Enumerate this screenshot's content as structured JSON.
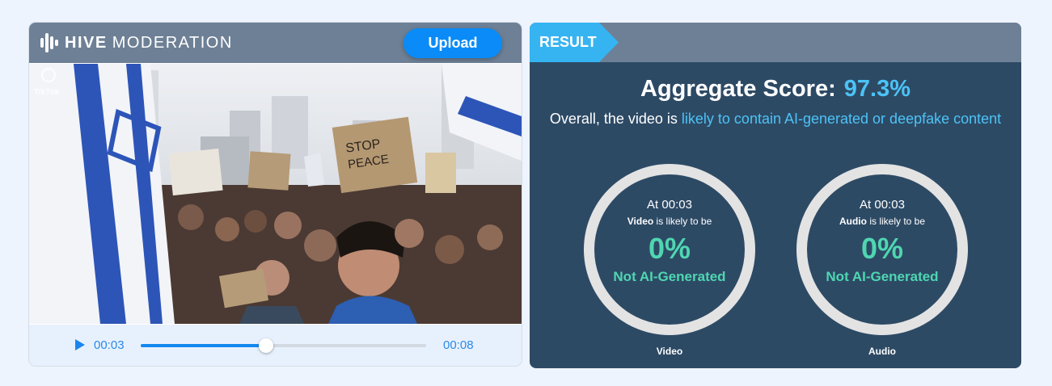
{
  "brand": {
    "name_bold": "HIVE",
    "name_light": "MODERATION"
  },
  "upload_label": "Upload",
  "player": {
    "current_time": "00:03",
    "total_time": "00:08",
    "progress": 0.44,
    "watermark": "TikTok"
  },
  "result": {
    "tab_label": "RESULT",
    "aggregate_label": "Aggregate Score:",
    "aggregate_score": "97.3%",
    "overall_prefix": "Overall, the video is ",
    "overall_highlight": "likely to contain AI-generated or deepfake content",
    "gauges": [
      {
        "timestamp": "At 00:03",
        "subject": "Video",
        "likely_text": " is likely to be",
        "percent": "0%",
        "verdict": "Not AI-Generated",
        "caption": "Video"
      },
      {
        "timestamp": "At 00:03",
        "subject": "Audio",
        "likely_text": " is likely to be",
        "percent": "0%",
        "verdict": "Not AI-Generated",
        "caption": "Audio"
      }
    ]
  },
  "colors": {
    "accent": "#0a8bf7",
    "highlight": "#4cc3f6",
    "safe": "#4fd6b1",
    "panel_dark": "#2d4a65",
    "header_gray": "#6e8096"
  }
}
